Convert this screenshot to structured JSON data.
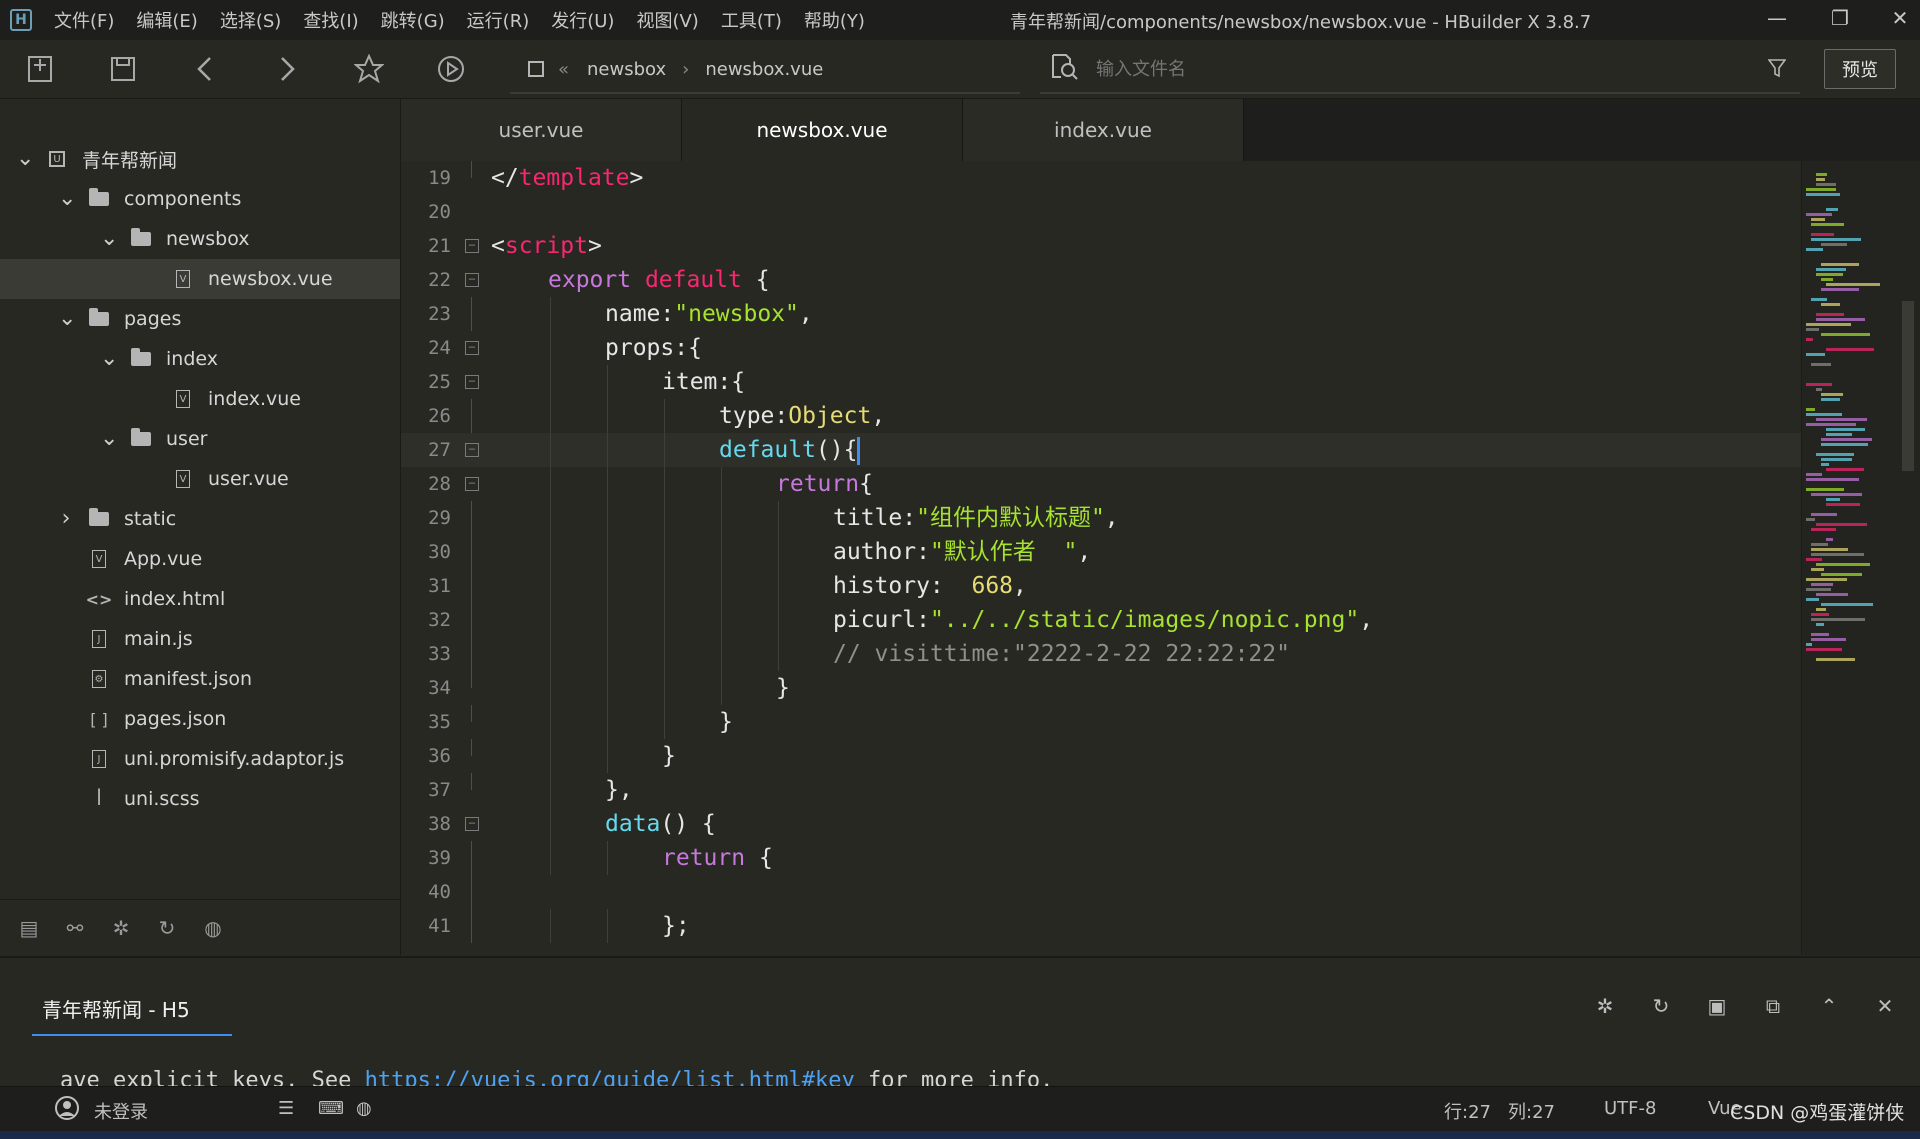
{
  "app": {
    "logo_letter": "H",
    "window_title": "青年帮新闻/components/newsbox/newsbox.vue - HBuilder X 3.8.7"
  },
  "menu": [
    "文件(F)",
    "编辑(E)",
    "选择(S)",
    "查找(I)",
    "跳转(G)",
    "运行(R)",
    "发行(U)",
    "视图(V)",
    "工具(T)",
    "帮助(Y)"
  ],
  "toolbar": {
    "breadcrumb": [
      "newsbox",
      "newsbox.vue"
    ],
    "search_placeholder": "输入文件名",
    "preview_label": "预览"
  },
  "sidebar": {
    "tree": [
      {
        "label": "青年帮新闻",
        "depth": 0,
        "kind": "project",
        "expanded": true
      },
      {
        "label": "components",
        "depth": 1,
        "kind": "folder",
        "expanded": true
      },
      {
        "label": "newsbox",
        "depth": 2,
        "kind": "folder",
        "expanded": true
      },
      {
        "label": "newsbox.vue",
        "depth": 3,
        "kind": "vue",
        "selected": true
      },
      {
        "label": "pages",
        "depth": 1,
        "kind": "folder",
        "expanded": true
      },
      {
        "label": "index",
        "depth": 2,
        "kind": "folder",
        "expanded": true
      },
      {
        "label": "index.vue",
        "depth": 3,
        "kind": "vue"
      },
      {
        "label": "user",
        "depth": 2,
        "kind": "folder",
        "expanded": true
      },
      {
        "label": "user.vue",
        "depth": 3,
        "kind": "vue"
      },
      {
        "label": "static",
        "depth": 1,
        "kind": "folder",
        "expanded": false
      },
      {
        "label": "App.vue",
        "depth": 1,
        "kind": "vue"
      },
      {
        "label": "index.html",
        "depth": 1,
        "kind": "html"
      },
      {
        "label": "main.js",
        "depth": 1,
        "kind": "js"
      },
      {
        "label": "manifest.json",
        "depth": 1,
        "kind": "manifest"
      },
      {
        "label": "pages.json",
        "depth": 1,
        "kind": "json"
      },
      {
        "label": "uni.promisify.adaptor.js",
        "depth": 1,
        "kind": "js"
      },
      {
        "label": "uni.scss",
        "depth": 1,
        "kind": "scss"
      }
    ]
  },
  "tabs": [
    {
      "label": "user.vue",
      "active": false
    },
    {
      "label": "newsbox.vue",
      "active": true
    },
    {
      "label": "index.vue",
      "active": false
    }
  ],
  "editor": {
    "current_line": 27,
    "lines": [
      {
        "n": "19",
        "indent": 0,
        "fold": "end",
        "html": "<span class=\"prop\">&lt;/</span><span class=\"tag\">template</span><span class=\"prop\">&gt;</span>"
      },
      {
        "n": "20",
        "indent": 0,
        "fold": "",
        "html": ""
      },
      {
        "n": "21",
        "indent": 0,
        "fold": "box",
        "html": "<span class=\"prop\">&lt;</span><span class=\"tag\">script</span><span class=\"prop\">&gt;</span>"
      },
      {
        "n": "22",
        "indent": 1,
        "fold": "box",
        "html": "<span class=\"kw\">export</span> <span class=\"tag\">default</span> <span class=\"prop\">{</span>"
      },
      {
        "n": "23",
        "indent": 2,
        "fold": "line",
        "html": "<span class=\"prop\">name:</span><span class=\"str\">\"newsbox\"</span><span class=\"prop\">,</span>"
      },
      {
        "n": "24",
        "indent": 2,
        "fold": "box",
        "html": "<span class=\"prop\">props:{</span>"
      },
      {
        "n": "25",
        "indent": 3,
        "fold": "box",
        "html": "<span class=\"prop\">item:{</span>"
      },
      {
        "n": "26",
        "indent": 4,
        "fold": "line",
        "html": "<span class=\"prop\">type:</span><span class=\"obj\">Object</span><span class=\"prop\">,</span>"
      },
      {
        "n": "27",
        "indent": 4,
        "fold": "box",
        "html": "<span class=\"fn\">default</span><span class=\"prop\">(){</span><span class=\"caret\"></span>"
      },
      {
        "n": "28",
        "indent": 5,
        "fold": "box",
        "html": "<span class=\"kw\">return</span><span class=\"prop\">{</span>"
      },
      {
        "n": "29",
        "indent": 6,
        "fold": "line",
        "html": "<span class=\"prop\">title:</span><span class=\"str\">\"组件内默认标题\"</span><span class=\"prop\">,</span>"
      },
      {
        "n": "30",
        "indent": 6,
        "fold": "line",
        "html": "<span class=\"prop\">author:</span><span class=\"str\">\"默认作者  \"</span><span class=\"prop\">,</span>"
      },
      {
        "n": "31",
        "indent": 6,
        "fold": "line",
        "html": "<span class=\"prop\">history:  </span><span class=\"num\">668</span><span class=\"prop\">,</span>"
      },
      {
        "n": "32",
        "indent": 6,
        "fold": "line",
        "html": "<span class=\"prop\">picurl:</span><span class=\"str\">\"../../static/images/nopic.png\"</span><span class=\"prop\">,</span>"
      },
      {
        "n": "33",
        "indent": 6,
        "fold": "line",
        "html": "<span class=\"cm\">// visittime:\"2222-2-22 22:22:22\"</span>"
      },
      {
        "n": "34",
        "indent": 5,
        "fold": "end",
        "html": "<span class=\"prop\">}</span>"
      },
      {
        "n": "35",
        "indent": 4,
        "fold": "end",
        "html": "<span class=\"prop\">}</span>"
      },
      {
        "n": "36",
        "indent": 3,
        "fold": "end",
        "html": "<span class=\"prop\">}</span>"
      },
      {
        "n": "37",
        "indent": 2,
        "fold": "end",
        "html": "<span class=\"prop\">},</span>"
      },
      {
        "n": "38",
        "indent": 2,
        "fold": "box",
        "html": "<span class=\"fn\">data</span><span class=\"prop\">() {</span>"
      },
      {
        "n": "39",
        "indent": 3,
        "fold": "line",
        "html": "<span class=\"kw\">return</span> <span class=\"prop\">{</span>"
      },
      {
        "n": "40",
        "indent": 0,
        "fold": "line",
        "html": ""
      },
      {
        "n": "41",
        "indent": 3,
        "fold": "line",
        "html": "<span class=\"prop\">};</span>"
      }
    ]
  },
  "console": {
    "tab_label": "青年帮新闻 - H5",
    "log_prefix": "ave explicit keys. See ",
    "log_link": "https://vuejs.org/guide/list.html#key",
    "log_suffix": " for more info."
  },
  "statusbar": {
    "login": "未登录",
    "row": "行:27",
    "col": "列:27",
    "encoding": "UTF-8",
    "language": "Vue",
    "watermark": "CSDN @鸡蛋灌饼侠"
  },
  "colors": {
    "background": "#272822",
    "accent": "#3d8ef0",
    "keyword": "#c678dd",
    "string": "#a6e22e",
    "tag": "#f92672"
  }
}
